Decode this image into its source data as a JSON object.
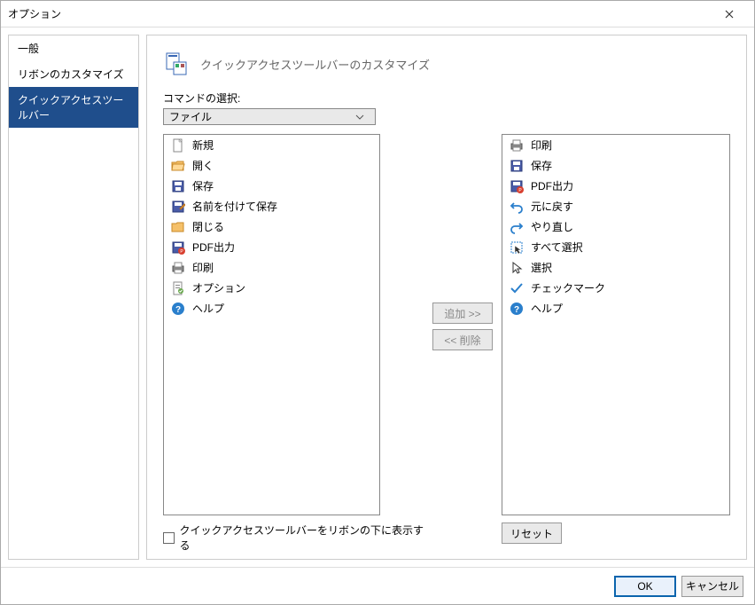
{
  "titlebar": {
    "title": "オプション"
  },
  "sidebar": {
    "items": [
      {
        "label": "一般"
      },
      {
        "label": "リボンのカスタマイズ"
      },
      {
        "label": "クイックアクセスツールバー"
      }
    ]
  },
  "main": {
    "header": "クイックアクセスツールバーのカスタマイズ",
    "command_label": "コマンドの選択:",
    "dropdown_value": "ファイル",
    "left_list": [
      {
        "icon": "file-new-icon",
        "label": "新規"
      },
      {
        "icon": "folder-open-icon",
        "label": "開く"
      },
      {
        "icon": "save-icon",
        "label": "保存"
      },
      {
        "icon": "save-as-icon",
        "label": "名前を付けて保存"
      },
      {
        "icon": "folder-close-icon",
        "label": "閉じる"
      },
      {
        "icon": "pdf-icon",
        "label": "PDF出力"
      },
      {
        "icon": "print-icon",
        "label": "印刷"
      },
      {
        "icon": "options-icon",
        "label": "オプション"
      },
      {
        "icon": "help-icon",
        "label": "ヘルプ"
      }
    ],
    "right_list": [
      {
        "icon": "print-icon",
        "label": "印刷"
      },
      {
        "icon": "save-icon",
        "label": "保存"
      },
      {
        "icon": "pdf-icon",
        "label": "PDF出力"
      },
      {
        "icon": "undo-icon",
        "label": "元に戻す"
      },
      {
        "icon": "redo-icon",
        "label": "やり直し"
      },
      {
        "icon": "select-all-icon",
        "label": "すべて選択"
      },
      {
        "icon": "pointer-icon",
        "label": "選択"
      },
      {
        "icon": "check-icon",
        "label": "チェックマーク"
      },
      {
        "icon": "help-icon",
        "label": "ヘルプ"
      }
    ],
    "add_button": "追加 >>",
    "remove_button": "<< 削除",
    "reset_button": "リセット",
    "checkbox_label": "クイックアクセスツールバーをリボンの下に表示する"
  },
  "footer": {
    "ok": "OK",
    "cancel": "キャンセル"
  }
}
